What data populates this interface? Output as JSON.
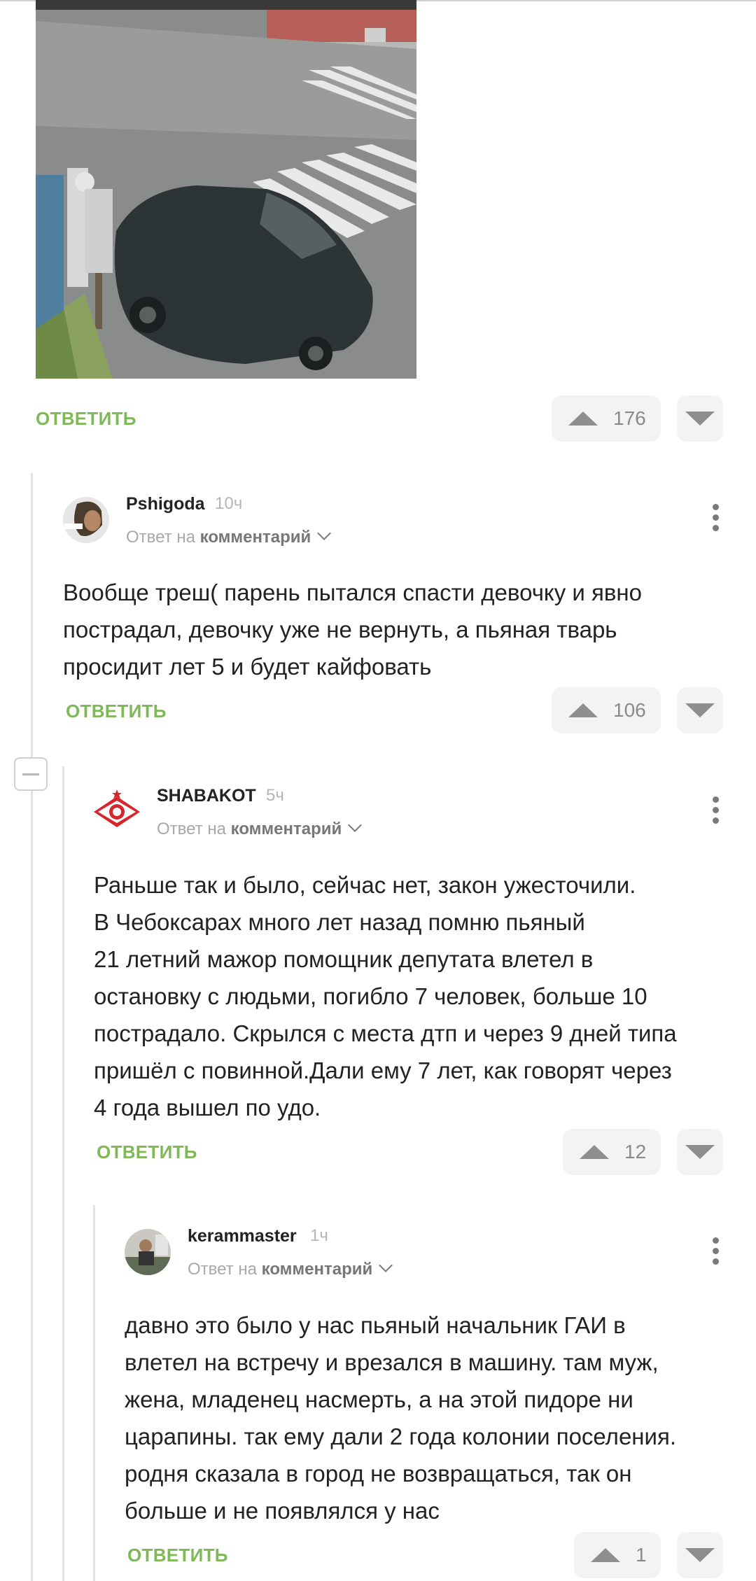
{
  "post_image": {
    "alt": ""
  },
  "colors": {
    "accent_green": "#7fb956",
    "vote_bg": "#f3f3f3",
    "thread_line": "#e3e3e3"
  },
  "top_actions": {
    "reply_label": "Ответить",
    "rating": "176"
  },
  "comments": [
    {
      "username": "Pshigoda",
      "time": "10ч",
      "reply_prefix": "Ответ на",
      "reply_target": "комментарий",
      "text": [
        "Вообще треш( парень пытался спасти девочку и явно",
        "пострадал, девочку уже не вернуть, а пьяная тварь",
        "просидит лет 5 и будет кайфовать"
      ],
      "reply_label": "Ответить",
      "rating": "106"
    },
    {
      "username": "SHABAKOT",
      "time": "5ч",
      "reply_prefix": "Ответ на",
      "reply_target": "комментарий",
      "text": [
        "Раньше так и было, сейчас нет, закон ужесточили.",
        "В Чебоксарах много лет назад помню пьяный",
        "21 летний мажор помощник депутата влетел в",
        "остановку с людьми, погибло 7 человек, больше 10",
        "пострадало. Скрылся с места дтп и через 9 дней типа",
        "пришёл с повинной.Дали ему 7 лет, как говорят через",
        "4 года вышел по удо."
      ],
      "reply_label": "Ответить",
      "rating": "12"
    },
    {
      "username": "kerammaster",
      "time": "1ч",
      "reply_prefix": "Ответ на",
      "reply_target": "комментарий",
      "text": [
        "давно это было у нас пьяный начальник ГАИ в",
        "влетел на встречу и врезался в машину. там муж,",
        "жена, младенец насмерть, а на этой пидоре ни",
        "царапины. так ему дали 2 года колонии поселения.",
        "родня сказала в город не возвращаться, так он",
        "больше и не появлялся у нас"
      ],
      "reply_label": "Ответить",
      "rating": "1"
    }
  ]
}
